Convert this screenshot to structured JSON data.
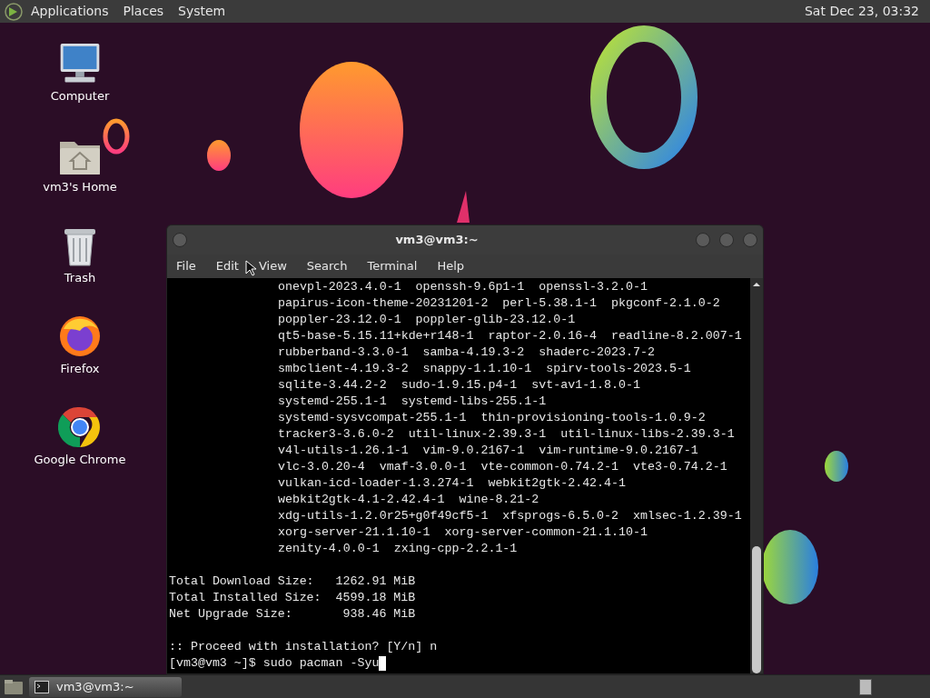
{
  "top_panel": {
    "menus": [
      "Applications",
      "Places",
      "System"
    ],
    "clock": "Sat Dec 23, 03:32"
  },
  "desktop_icons": [
    {
      "label": "Computer",
      "kind": "computer"
    },
    {
      "label": "vm3's Home",
      "kind": "home"
    },
    {
      "label": "Trash",
      "kind": "trash"
    },
    {
      "label": "Firefox",
      "kind": "firefox"
    },
    {
      "label": "Google Chrome",
      "kind": "chrome"
    }
  ],
  "terminal": {
    "title": "vm3@vm3:~",
    "menu": [
      "File",
      "Edit",
      "View",
      "Search",
      "Terminal",
      "Help"
    ],
    "package_lines": [
      "onevpl-2023.4.0-1  openssh-9.6p1-1  openssl-3.2.0-1",
      "papirus-icon-theme-20231201-2  perl-5.38.1-1  pkgconf-2.1.0-2",
      "poppler-23.12.0-1  poppler-glib-23.12.0-1",
      "qt5-base-5.15.11+kde+r148-1  raptor-2.0.16-4  readline-8.2.007-1",
      "rubberband-3.3.0-1  samba-4.19.3-2  shaderc-2023.7-2",
      "smbclient-4.19.3-2  snappy-1.1.10-1  spirv-tools-2023.5-1",
      "sqlite-3.44.2-2  sudo-1.9.15.p4-1  svt-av1-1.8.0-1",
      "systemd-255.1-1  systemd-libs-255.1-1",
      "systemd-sysvcompat-255.1-1  thin-provisioning-tools-1.0.9-2",
      "tracker3-3.6.0-2  util-linux-2.39.3-1  util-linux-libs-2.39.3-1",
      "v4l-utils-1.26.1-1  vim-9.0.2167-1  vim-runtime-9.0.2167-1",
      "vlc-3.0.20-4  vmaf-3.0.0-1  vte-common-0.74.2-1  vte3-0.74.2-1",
      "vulkan-icd-loader-1.3.274-1  webkit2gtk-2.42.4-1",
      "webkit2gtk-4.1-2.42.4-1  wine-8.21-2",
      "xdg-utils-1.2.0r25+g0f49cf5-1  xfsprogs-6.5.0-2  xmlsec-1.2.39-1",
      "xorg-server-21.1.10-1  xorg-server-common-21.1.10-1",
      "zenity-4.0.0-1  zxing-cpp-2.2.1-1"
    ],
    "summary_lines": [
      "Total Download Size:   1262.91 MiB",
      "Total Installed Size:  4599.18 MiB",
      "Net Upgrade Size:       938.46 MiB"
    ],
    "question": ":: Proceed with installation? [Y/n] n",
    "prompt": "[vm3@vm3 ~]$ sudo pacman -Syu"
  },
  "taskbar": {
    "tasks": [
      {
        "label": "vm3@vm3:~"
      }
    ]
  }
}
